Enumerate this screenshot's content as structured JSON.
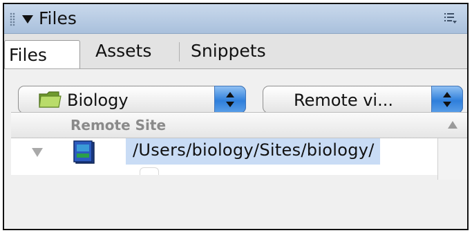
{
  "panel": {
    "title": "Files",
    "collapse_icon": "disclosure-triangle-down",
    "options_icon": "panel-options-menu-icon"
  },
  "tabs": [
    {
      "label": "Files",
      "active": true
    },
    {
      "label": "Assets",
      "active": false
    },
    {
      "label": "Snippets",
      "active": false
    }
  ],
  "site_select": {
    "value": "Biology",
    "icon": "folder-icon"
  },
  "view_select": {
    "value": "Remote vi..."
  },
  "toolbar": [
    {
      "name": "connect-button",
      "icon": "plug-connect-icon"
    },
    {
      "name": "refresh-button",
      "icon": "refresh-icon"
    },
    {
      "name": "get-button",
      "icon": "down-arrow-icon"
    },
    {
      "name": "put-button",
      "icon": "up-arrow-icon"
    },
    {
      "name": "check-out-button",
      "icon": "check-out-icon"
    },
    {
      "name": "check-in-button",
      "icon": "check-in-lock-icon"
    },
    {
      "name": "synchronize-button",
      "icon": "sync-icon"
    },
    {
      "name": "expand-button",
      "icon": "expand-window-icon"
    }
  ],
  "file_list": {
    "column_header": "Remote Site",
    "rows": [
      {
        "path": "/Users/biology/Sites/biology/",
        "icon": "server-folder-icon",
        "expanded": true
      }
    ]
  },
  "colors": {
    "header_blue": "#b5cae4",
    "selection_blue": "#c9dcf5",
    "stepper_blue": "#2f7fdb",
    "get_green": "#4caf3a",
    "put_blue": "#3b8fe0"
  }
}
